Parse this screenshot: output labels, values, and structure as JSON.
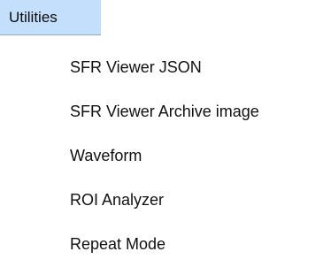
{
  "menu": {
    "title": "Utilities",
    "items": [
      {
        "label": "SFR Viewer JSON"
      },
      {
        "label": "SFR Viewer Archive image"
      },
      {
        "label": "Waveform"
      },
      {
        "label": "ROI Analyzer"
      },
      {
        "label": "Repeat Mode"
      }
    ]
  },
  "colors": {
    "menu_title_background": "#c3dffb",
    "menu_title_border": "#8ea9c6",
    "text": "#111111",
    "background": "#ffffff"
  }
}
